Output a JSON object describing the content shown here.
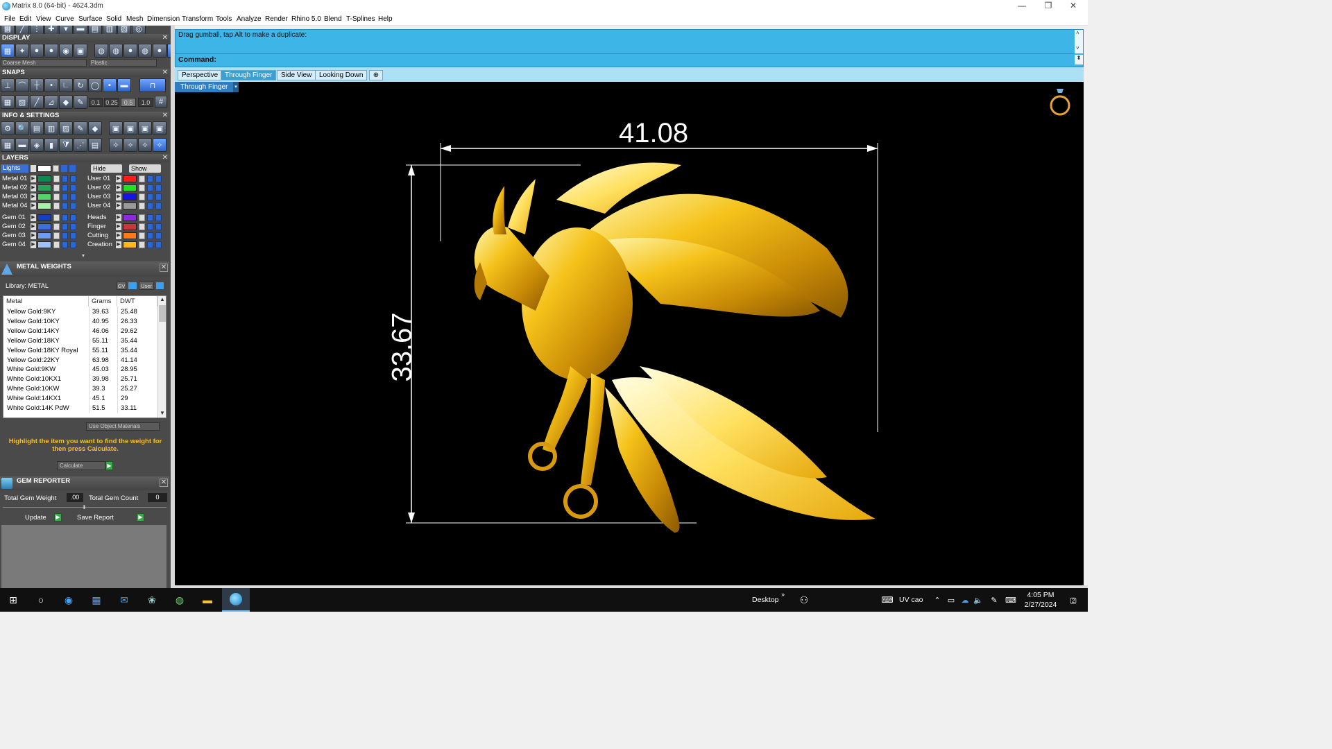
{
  "window": {
    "title": "Matrix 8.0 (64-bit) - 4624.3dm",
    "controls": [
      "—",
      "❐",
      "✕"
    ]
  },
  "menu": [
    "File",
    "Edit",
    "View",
    "Curve",
    "Surface",
    "Solid",
    "Mesh",
    "Dimension",
    "Transform",
    "Tools",
    "Analyze",
    "Render",
    "Rhino 5.0",
    "Blend",
    "T-Splines",
    "Help"
  ],
  "display": {
    "title": "DISPLAY",
    "mesh_combo": "Coarse Mesh",
    "material_combo": "Plastic"
  },
  "snaps": {
    "title": "SNAPS",
    "values": [
      "0.1",
      "0.25",
      "0.5",
      "1.0"
    ]
  },
  "info": {
    "title": "INFO & SETTINGS"
  },
  "layers": {
    "title": "LAYERS",
    "lights": "Lights",
    "hide": "Hide",
    "show": "Show",
    "left": [
      {
        "name": "Metal 01",
        "color": "#0f8a4e"
      },
      {
        "name": "Metal 02",
        "color": "#22a55a"
      },
      {
        "name": "Metal 03",
        "color": "#56d36a"
      },
      {
        "name": "Metal 04",
        "color": "#a9f0a8"
      },
      {
        "name": "Gem 01",
        "color": "#1740b8"
      },
      {
        "name": "Gem 02",
        "color": "#3d6fe0"
      },
      {
        "name": "Gem 03",
        "color": "#6f9cf0"
      },
      {
        "name": "Gem 04",
        "color": "#9fc3f8"
      }
    ],
    "right": [
      {
        "name": "User 01",
        "color": "#ff1c1c"
      },
      {
        "name": "User 02",
        "color": "#22e022"
      },
      {
        "name": "User 03",
        "color": "#1414e8"
      },
      {
        "name": "User 04",
        "color": "#9a9a9a"
      },
      {
        "name": "Heads",
        "color": "#8a2be2"
      },
      {
        "name": "Finger",
        "color": "#c8383a"
      },
      {
        "name": "Cutting",
        "color": "#ff7a1a"
      },
      {
        "name": "Creation",
        "color": "#ffb81c"
      }
    ]
  },
  "metal_weights": {
    "title": "METAL WEIGHTS",
    "library": "Library: METAL",
    "gv": "GV",
    "user": "User",
    "columns": [
      "Metal",
      "Grams",
      "DWT"
    ],
    "rows": [
      [
        "Yellow Gold:9KY",
        "39.63",
        "25.48"
      ],
      [
        "Yellow Gold:10KY",
        "40.95",
        "26.33"
      ],
      [
        "Yellow Gold:14KY",
        "46.06",
        "29.62"
      ],
      [
        "Yellow Gold:18KY",
        "55.11",
        "35.44"
      ],
      [
        "Yellow Gold:18KY Royal",
        "55.11",
        "35.44"
      ],
      [
        "Yellow Gold:22KY",
        "63.98",
        "41.14"
      ],
      [
        "White Gold:9KW",
        "45.03",
        "28.95"
      ],
      [
        "White Gold:10KX1",
        "39.98",
        "25.71"
      ],
      [
        "White Gold:10KW",
        "39.3",
        "25.27"
      ],
      [
        "White Gold:14KX1",
        "45.1",
        "29"
      ],
      [
        "White Gold:14K PdW",
        "51.5",
        "33.11"
      ]
    ],
    "use_object_materials": "Use Object Materials",
    "hint": "Highlight the item you want to find the weight for then press Calculate.",
    "calculate": "Calculate"
  },
  "gem_reporter": {
    "title": "GEM REPORTER",
    "total_weight_label": "Total Gem Weight",
    "total_weight_value": ".00",
    "total_count_label": "Total Gem Count",
    "total_count_value": "0",
    "update": "Update",
    "save_report": "Save Report"
  },
  "command": {
    "history": "Drag gumball, tap Alt to make a duplicate:",
    "prompt": "Command:"
  },
  "viewport": {
    "tabs": [
      "Perspective",
      "Through Finger",
      "Side View",
      "Looking Down"
    ],
    "active_tab": "Through Finger",
    "view_label": "Through Finger",
    "dim_width": "41.08",
    "dim_height": "33.67"
  },
  "taskbar": {
    "desktop": "Desktop",
    "keyboard": "UV cao",
    "time": "4:05 PM",
    "date": "2/27/2024",
    "notifications": "2"
  }
}
